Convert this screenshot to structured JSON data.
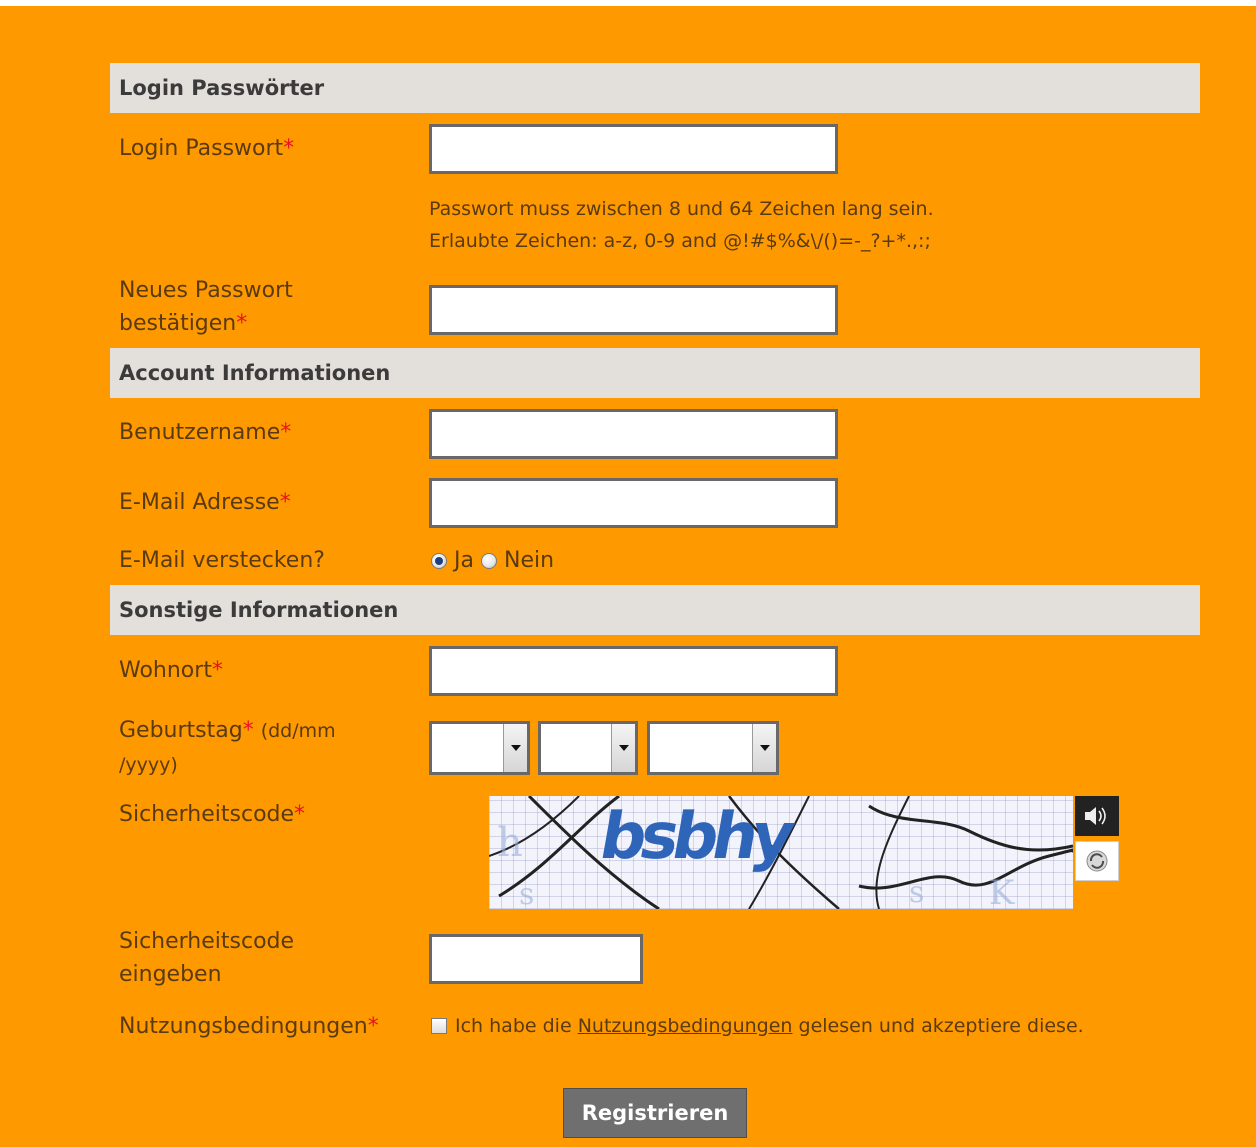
{
  "sections": {
    "login": "Login Passwörter",
    "account": "Account Informationen",
    "other": "Sonstige Informationen"
  },
  "fields": {
    "login_password": {
      "label": "Login Passwort",
      "required": "*",
      "value": ""
    },
    "password_hint_line1": "Passwort muss zwischen 8 und 64 Zeichen lang sein.",
    "password_hint_line2": "Erlaubte Zeichen: a-z, 0-9 and @!#$%&\\/()=-_?+*.,:;",
    "confirm_password": {
      "label_line1": "Neues Passwort",
      "label_line2": "bestätigen",
      "required": "*",
      "value": ""
    },
    "username": {
      "label": "Benutzername",
      "required": "*",
      "value": ""
    },
    "email": {
      "label": "E-Mail Adresse",
      "required": "*",
      "value": ""
    },
    "hide_email": {
      "label": "E-Mail verstecken?",
      "option_yes": "Ja",
      "option_no": "Nein",
      "selected": "Ja"
    },
    "residence": {
      "label": "Wohnort",
      "required": "*",
      "value": ""
    },
    "birthday": {
      "label": "Geburtstag",
      "required": "*",
      "format_line1": "(dd/mm",
      "format_line2": "/yyyy)",
      "day": "",
      "month": "",
      "year": ""
    },
    "security_code": {
      "label": "Sicherheitscode",
      "required": "*",
      "captcha_text": "bsbhy"
    },
    "security_code_input": {
      "label_line1": "Sicherheitscode",
      "label_line2": "eingeben",
      "value": ""
    },
    "terms": {
      "label": "Nutzungsbedingungen",
      "required": "*",
      "text_before": "Ich habe die",
      "link_text": "Nutzungsbedingungen",
      "text_after": "gelesen und akzeptiere diese.",
      "checked": false
    }
  },
  "submit_label": "Registrieren",
  "icons": {
    "audio": "speaker-icon",
    "refresh": "refresh-icon"
  },
  "colors": {
    "background": "#ff9900",
    "section_bar": "#e3dfda",
    "required": "#e8141e",
    "button": "#6f6f6f"
  }
}
